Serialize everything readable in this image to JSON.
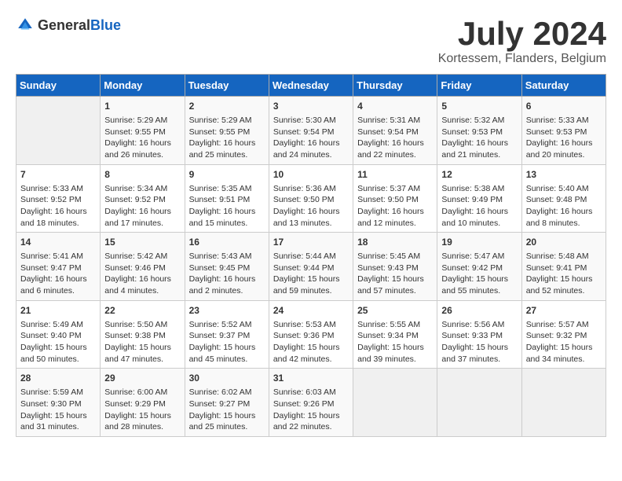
{
  "logo": {
    "general": "General",
    "blue": "Blue"
  },
  "header": {
    "month": "July 2024",
    "location": "Kortessem, Flanders, Belgium"
  },
  "columns": [
    "Sunday",
    "Monday",
    "Tuesday",
    "Wednesday",
    "Thursday",
    "Friday",
    "Saturday"
  ],
  "weeks": [
    [
      {
        "day": "",
        "info": ""
      },
      {
        "day": "1",
        "info": "Sunrise: 5:29 AM\nSunset: 9:55 PM\nDaylight: 16 hours\nand 26 minutes."
      },
      {
        "day": "2",
        "info": "Sunrise: 5:29 AM\nSunset: 9:55 PM\nDaylight: 16 hours\nand 25 minutes."
      },
      {
        "day": "3",
        "info": "Sunrise: 5:30 AM\nSunset: 9:54 PM\nDaylight: 16 hours\nand 24 minutes."
      },
      {
        "day": "4",
        "info": "Sunrise: 5:31 AM\nSunset: 9:54 PM\nDaylight: 16 hours\nand 22 minutes."
      },
      {
        "day": "5",
        "info": "Sunrise: 5:32 AM\nSunset: 9:53 PM\nDaylight: 16 hours\nand 21 minutes."
      },
      {
        "day": "6",
        "info": "Sunrise: 5:33 AM\nSunset: 9:53 PM\nDaylight: 16 hours\nand 20 minutes."
      }
    ],
    [
      {
        "day": "7",
        "info": "Sunrise: 5:33 AM\nSunset: 9:52 PM\nDaylight: 16 hours\nand 18 minutes."
      },
      {
        "day": "8",
        "info": "Sunrise: 5:34 AM\nSunset: 9:52 PM\nDaylight: 16 hours\nand 17 minutes."
      },
      {
        "day": "9",
        "info": "Sunrise: 5:35 AM\nSunset: 9:51 PM\nDaylight: 16 hours\nand 15 minutes."
      },
      {
        "day": "10",
        "info": "Sunrise: 5:36 AM\nSunset: 9:50 PM\nDaylight: 16 hours\nand 13 minutes."
      },
      {
        "day": "11",
        "info": "Sunrise: 5:37 AM\nSunset: 9:50 PM\nDaylight: 16 hours\nand 12 minutes."
      },
      {
        "day": "12",
        "info": "Sunrise: 5:38 AM\nSunset: 9:49 PM\nDaylight: 16 hours\nand 10 minutes."
      },
      {
        "day": "13",
        "info": "Sunrise: 5:40 AM\nSunset: 9:48 PM\nDaylight: 16 hours\nand 8 minutes."
      }
    ],
    [
      {
        "day": "14",
        "info": "Sunrise: 5:41 AM\nSunset: 9:47 PM\nDaylight: 16 hours\nand 6 minutes."
      },
      {
        "day": "15",
        "info": "Sunrise: 5:42 AM\nSunset: 9:46 PM\nDaylight: 16 hours\nand 4 minutes."
      },
      {
        "day": "16",
        "info": "Sunrise: 5:43 AM\nSunset: 9:45 PM\nDaylight: 16 hours\nand 2 minutes."
      },
      {
        "day": "17",
        "info": "Sunrise: 5:44 AM\nSunset: 9:44 PM\nDaylight: 15 hours\nand 59 minutes."
      },
      {
        "day": "18",
        "info": "Sunrise: 5:45 AM\nSunset: 9:43 PM\nDaylight: 15 hours\nand 57 minutes."
      },
      {
        "day": "19",
        "info": "Sunrise: 5:47 AM\nSunset: 9:42 PM\nDaylight: 15 hours\nand 55 minutes."
      },
      {
        "day": "20",
        "info": "Sunrise: 5:48 AM\nSunset: 9:41 PM\nDaylight: 15 hours\nand 52 minutes."
      }
    ],
    [
      {
        "day": "21",
        "info": "Sunrise: 5:49 AM\nSunset: 9:40 PM\nDaylight: 15 hours\nand 50 minutes."
      },
      {
        "day": "22",
        "info": "Sunrise: 5:50 AM\nSunset: 9:38 PM\nDaylight: 15 hours\nand 47 minutes."
      },
      {
        "day": "23",
        "info": "Sunrise: 5:52 AM\nSunset: 9:37 PM\nDaylight: 15 hours\nand 45 minutes."
      },
      {
        "day": "24",
        "info": "Sunrise: 5:53 AM\nSunset: 9:36 PM\nDaylight: 15 hours\nand 42 minutes."
      },
      {
        "day": "25",
        "info": "Sunrise: 5:55 AM\nSunset: 9:34 PM\nDaylight: 15 hours\nand 39 minutes."
      },
      {
        "day": "26",
        "info": "Sunrise: 5:56 AM\nSunset: 9:33 PM\nDaylight: 15 hours\nand 37 minutes."
      },
      {
        "day": "27",
        "info": "Sunrise: 5:57 AM\nSunset: 9:32 PM\nDaylight: 15 hours\nand 34 minutes."
      }
    ],
    [
      {
        "day": "28",
        "info": "Sunrise: 5:59 AM\nSunset: 9:30 PM\nDaylight: 15 hours\nand 31 minutes."
      },
      {
        "day": "29",
        "info": "Sunrise: 6:00 AM\nSunset: 9:29 PM\nDaylight: 15 hours\nand 28 minutes."
      },
      {
        "day": "30",
        "info": "Sunrise: 6:02 AM\nSunset: 9:27 PM\nDaylight: 15 hours\nand 25 minutes."
      },
      {
        "day": "31",
        "info": "Sunrise: 6:03 AM\nSunset: 9:26 PM\nDaylight: 15 hours\nand 22 minutes."
      },
      {
        "day": "",
        "info": ""
      },
      {
        "day": "",
        "info": ""
      },
      {
        "day": "",
        "info": ""
      }
    ]
  ]
}
